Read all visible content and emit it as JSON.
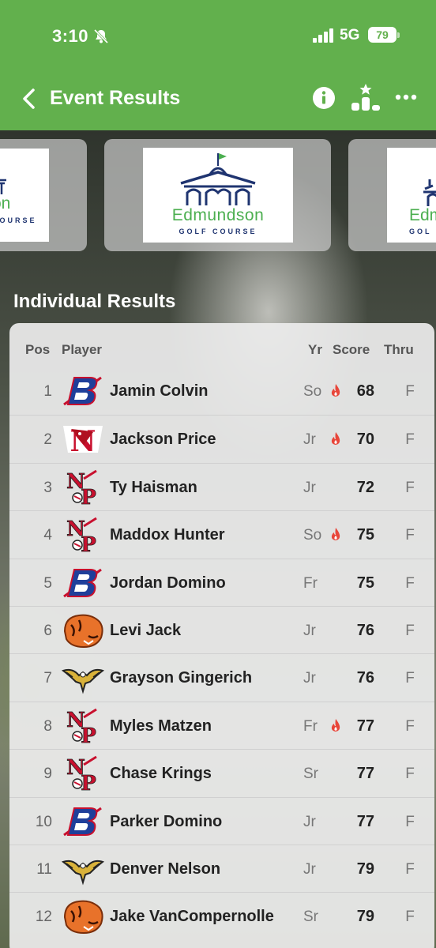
{
  "status_bar": {
    "time": "3:10",
    "network": "5G",
    "battery": "79"
  },
  "nav": {
    "title": "Event Results"
  },
  "sponsor": {
    "name": "Edmundson",
    "sub": "GOLF COURSE",
    "left_sub": "COURSE",
    "right_name": "Edm",
    "right_sub": "GOL"
  },
  "section_title": "Individual Results",
  "table": {
    "headers": {
      "pos": "Pos",
      "player": "Player",
      "yr": "Yr",
      "score": "Score",
      "thru": "Thru"
    },
    "rows": [
      {
        "pos": "1",
        "player": "Jamin Colvin",
        "yr": "So",
        "hot": true,
        "score": "68",
        "thru": "F",
        "team": "B"
      },
      {
        "pos": "2",
        "player": "Jackson Price",
        "yr": "Jr",
        "hot": true,
        "score": "70",
        "thru": "F",
        "team": "N"
      },
      {
        "pos": "3",
        "player": "Ty Haisman",
        "yr": "Jr",
        "hot": false,
        "score": "72",
        "thru": "F",
        "team": "NP"
      },
      {
        "pos": "4",
        "player": "Maddox Hunter",
        "yr": "So",
        "hot": true,
        "score": "75",
        "thru": "F",
        "team": "NP"
      },
      {
        "pos": "5",
        "player": "Jordan Domino",
        "yr": "Fr",
        "hot": false,
        "score": "75",
        "thru": "F",
        "team": "B"
      },
      {
        "pos": "6",
        "player": "Levi Jack",
        "yr": "Jr",
        "hot": false,
        "score": "76",
        "thru": "F",
        "team": "tiger"
      },
      {
        "pos": "7",
        "player": "Grayson Gingerich",
        "yr": "Jr",
        "hot": false,
        "score": "76",
        "thru": "F",
        "team": "eagle"
      },
      {
        "pos": "8",
        "player": "Myles Matzen",
        "yr": "Fr",
        "hot": true,
        "score": "77",
        "thru": "F",
        "team": "NP"
      },
      {
        "pos": "9",
        "player": "Chase Krings",
        "yr": "Sr",
        "hot": false,
        "score": "77",
        "thru": "F",
        "team": "NP"
      },
      {
        "pos": "10",
        "player": "Parker Domino",
        "yr": "Jr",
        "hot": false,
        "score": "77",
        "thru": "F",
        "team": "B"
      },
      {
        "pos": "11",
        "player": "Denver Nelson",
        "yr": "Jr",
        "hot": false,
        "score": "79",
        "thru": "F",
        "team": "eagle"
      },
      {
        "pos": "12",
        "player": "Jake VanCompernolle",
        "yr": "Sr",
        "hot": false,
        "score": "79",
        "thru": "F",
        "team": "tiger"
      }
    ]
  },
  "colors": {
    "accent": "#62b04d",
    "fire": "#e8463a",
    "logo_red": "#c8102e",
    "logo_blue": "#1f3f9a",
    "tiger_orange": "#e8722a"
  }
}
